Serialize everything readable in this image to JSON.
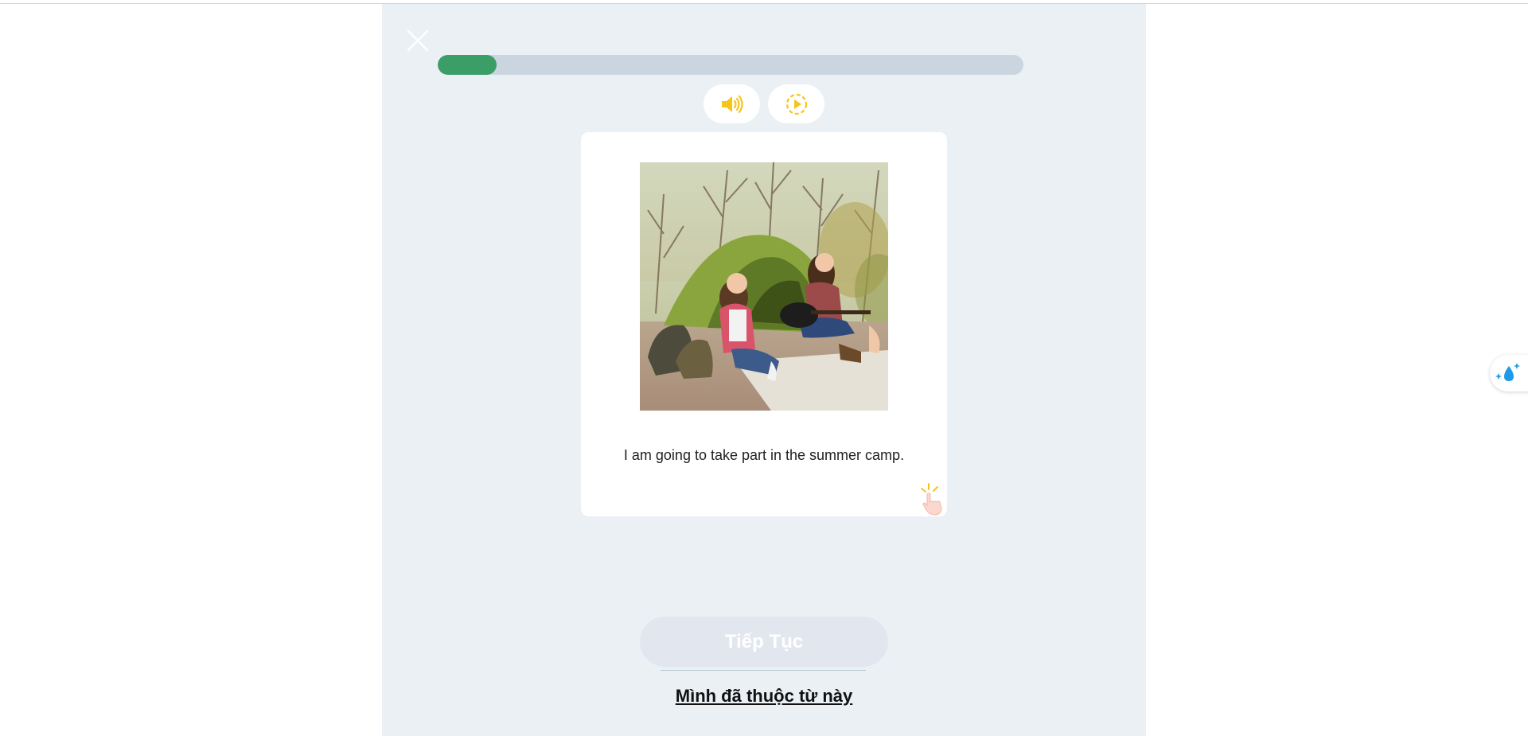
{
  "lesson": {
    "progress_fraction": 0.1
  },
  "card": {
    "image_alt": "Two girls sitting by a green tent, one playing guitar",
    "sentence": "I am going to take part in the summer camp."
  },
  "actions": {
    "continue_label": "Tiếp Tục",
    "known_word_label": "Mình đã thuộc từ này"
  },
  "icons": {
    "close": "close-icon",
    "audio": "speaker-icon",
    "slow_play": "slow-play-icon",
    "tap_hint": "tap-hand-icon",
    "side_widget": "water-drop-sparkle-icon"
  },
  "colors": {
    "progress_fill": "#3a9e66",
    "progress_track": "#cbd5df",
    "audio_icon": "#f5c518",
    "panel_bg": "#ebf0f5",
    "continue_disabled_bg": "#e2e7ef",
    "side_widget_icon": "#1e9be8"
  }
}
